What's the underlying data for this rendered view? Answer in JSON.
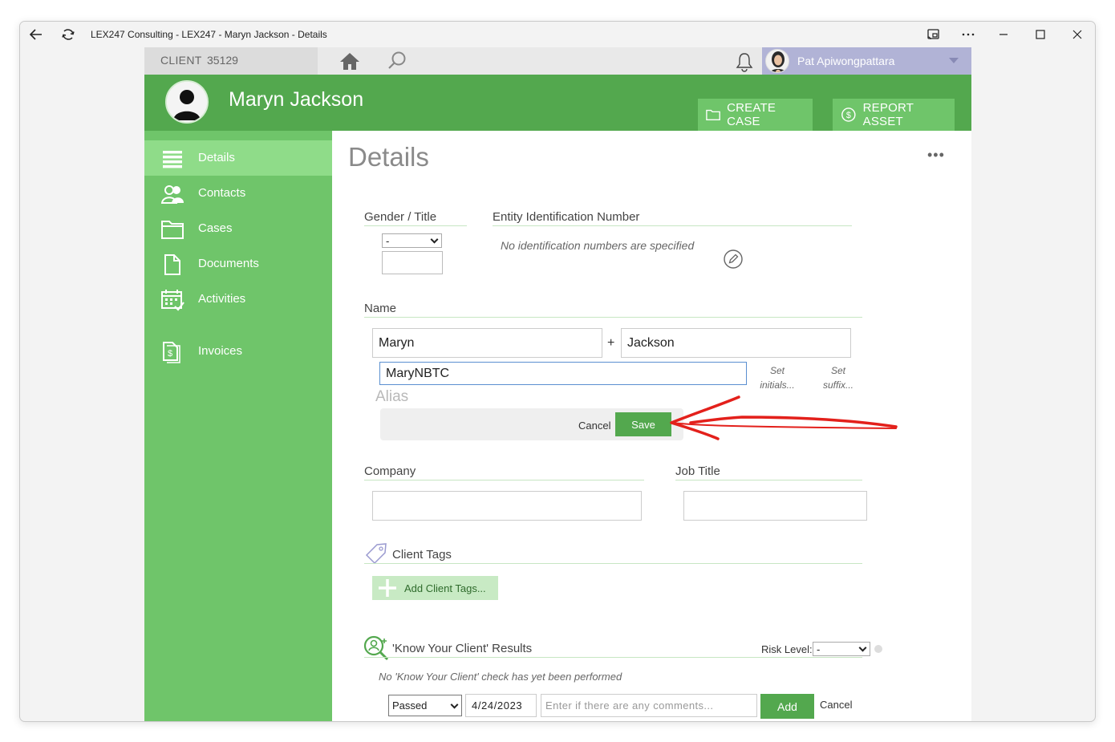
{
  "window": {
    "title": "LEX247 Consulting - LEX247 - Maryn Jackson - Details"
  },
  "topbar": {
    "client_label": "CLIENT",
    "client_number": "35129",
    "user_name": "Pat Apiwongpattara"
  },
  "header": {
    "client_name": "Maryn Jackson",
    "create_case_label": "CREATE CASE",
    "report_asset_label": "REPORT ASSET"
  },
  "sidebar": {
    "items": [
      {
        "label": "Details",
        "icon": "list-icon",
        "active": true
      },
      {
        "label": "Contacts",
        "icon": "contacts-icon",
        "active": false
      },
      {
        "label": "Cases",
        "icon": "folder-icon",
        "active": false
      },
      {
        "label": "Documents",
        "icon": "document-icon",
        "active": false
      },
      {
        "label": "Activities",
        "icon": "calendar-icon",
        "active": false
      },
      {
        "label": "Invoices",
        "icon": "invoice-icon",
        "active": false
      }
    ]
  },
  "main": {
    "title": "Details",
    "more_label": "•••",
    "gender_title": {
      "label": "Gender / Title",
      "select_value": "-",
      "title_value": ""
    },
    "entity_id": {
      "label": "Entity Identification Number",
      "empty_note": "No identification numbers are specified"
    },
    "name": {
      "label": "Name",
      "first_name": "Maryn",
      "plus": "+",
      "last_name": "Jackson",
      "alias_value": "MaryNBTC",
      "set_initials_line1": "Set",
      "set_initials_line2": "initials...",
      "set_suffix_line1": "Set",
      "set_suffix_line2": "suffix...",
      "alias_label": "Alias",
      "cancel_label": "Cancel",
      "save_label": "Save"
    },
    "company": {
      "label": "Company",
      "value": ""
    },
    "job_title": {
      "label": "Job Title",
      "value": ""
    },
    "client_tags": {
      "label": "Client Tags",
      "add_label": "Add Client Tags..."
    },
    "kyc": {
      "label": "'Know Your Client' Results",
      "risk_label": "Risk Level:",
      "risk_value": "-",
      "empty_note": "No 'Know Your Client' check has yet been performed",
      "result_value": "Passed",
      "date_value": "4/24/2023",
      "comment_placeholder": "Enter if there are any comments...",
      "add_label": "Add",
      "cancel_label": "Cancel"
    }
  },
  "colors": {
    "header_green": "#53a84e",
    "sidebar_green": "#6fc56a",
    "active_green": "#8fdc89",
    "user_bar": "#b1b3d6",
    "annotation_red": "#e3201b"
  }
}
